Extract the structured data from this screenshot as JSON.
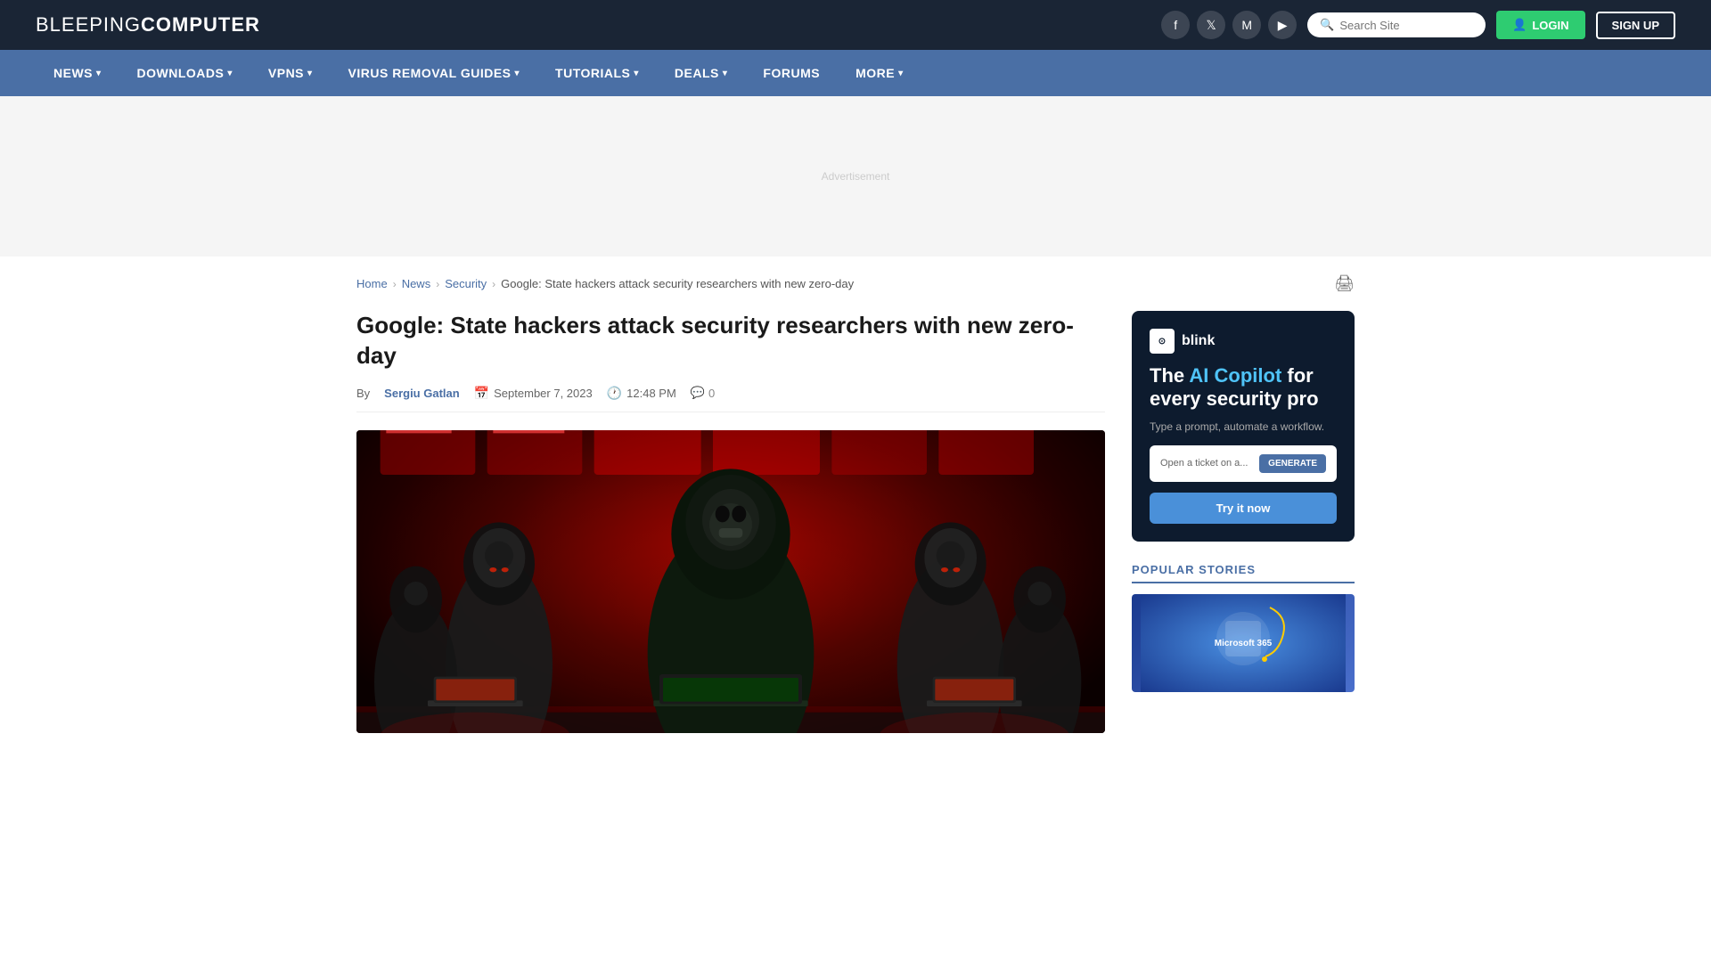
{
  "header": {
    "logo_light": "BLEEPING",
    "logo_bold": "COMPUTER",
    "search_placeholder": "Search Site",
    "login_label": "LOGIN",
    "signup_label": "SIGN UP"
  },
  "nav": {
    "items": [
      {
        "label": "NEWS",
        "has_dropdown": true
      },
      {
        "label": "DOWNLOADS",
        "has_dropdown": true
      },
      {
        "label": "VPNS",
        "has_dropdown": true
      },
      {
        "label": "VIRUS REMOVAL GUIDES",
        "has_dropdown": true
      },
      {
        "label": "TUTORIALS",
        "has_dropdown": true
      },
      {
        "label": "DEALS",
        "has_dropdown": true
      },
      {
        "label": "FORUMS",
        "has_dropdown": false
      },
      {
        "label": "MORE",
        "has_dropdown": true
      }
    ]
  },
  "breadcrumb": {
    "home": "Home",
    "news": "News",
    "security": "Security",
    "current": "Google: State hackers attack security researchers with new zero-day"
  },
  "article": {
    "title": "Google: State hackers attack security researchers with new zero-day",
    "author": "Sergiu Gatlan",
    "date": "September 7, 2023",
    "time": "12:48 PM",
    "comments": "0"
  },
  "sidebar": {
    "blink": {
      "logo_text": "blink",
      "headline_part1": "The ",
      "headline_highlight": "AI Copilot",
      "headline_part2": " for every security pro",
      "subtext": "Type a prompt, automate a workflow.",
      "input_placeholder": "Open a ticket on a...",
      "generate_label": "GENERATE",
      "cta_label": "Try it now"
    },
    "popular_title": "POPULAR STORIES"
  },
  "social": {
    "facebook": "f",
    "twitter": "𝕏",
    "mastodon": "M",
    "youtube": "▶"
  }
}
